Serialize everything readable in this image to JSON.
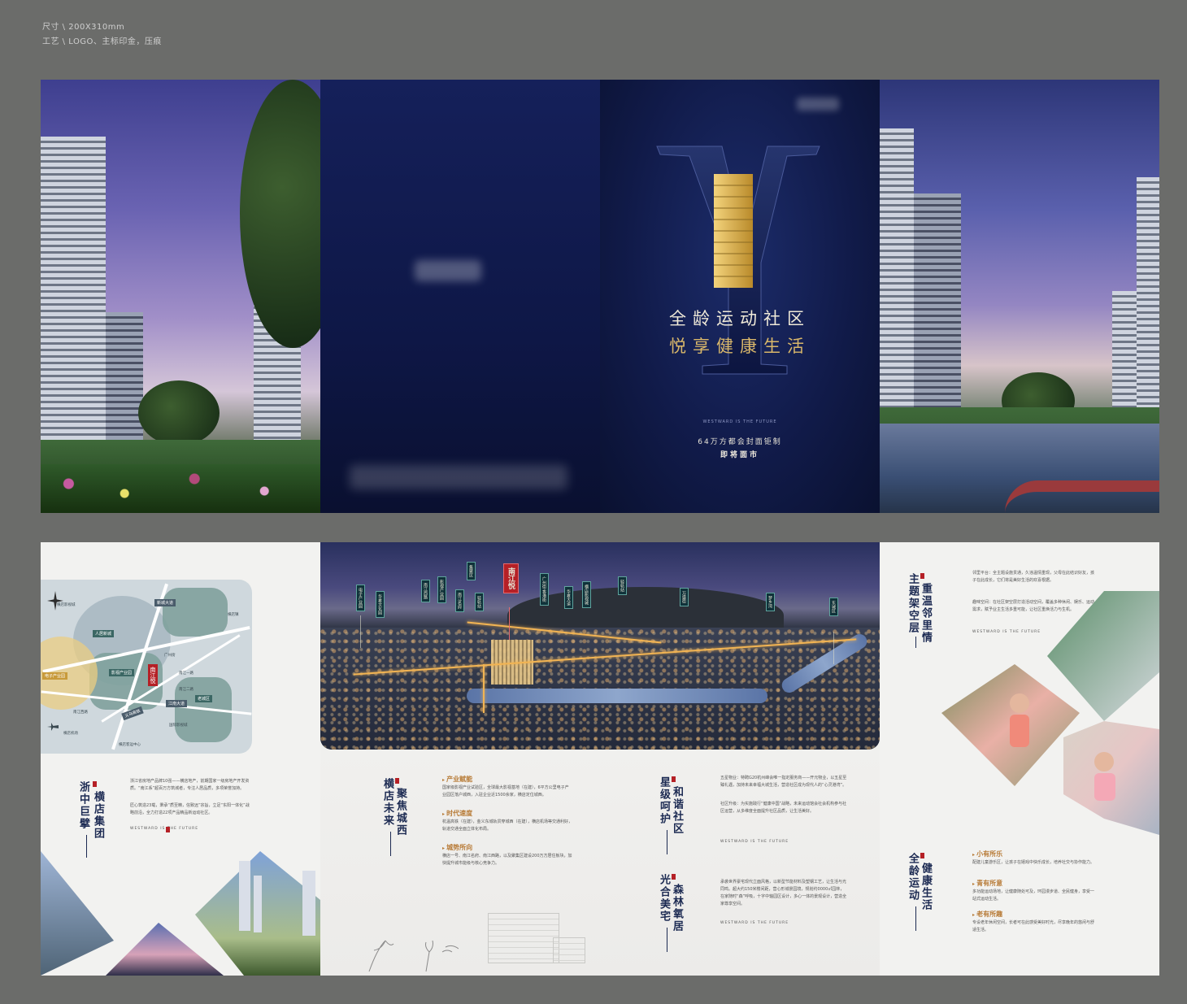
{
  "spec": {
    "size_line": "尺寸 \\ 200X310mm",
    "craft_line": "工艺 \\ LOGO、主标印金，压痕"
  },
  "cover": {
    "letter": "Y",
    "title_line1": "全龄运动社区",
    "title_line2": "悦享健康生活",
    "en_slogan": "WESTWARD IS THE FUTURE",
    "sub_line1": "64万方都会封面钜制",
    "sub_line2": "即将面市"
  },
  "map": {
    "project": "南江悦",
    "labels": [
      "人居新城",
      "影视产业园",
      "老城区",
      "电子产业园",
      "新城大道",
      "江南大道",
      "义乌高铁",
      "横店影视城"
    ],
    "small": [
      "横店机场",
      "南江一路",
      "南江二路",
      "广州街",
      "南江西路",
      "横店客运中心",
      "国际影视城",
      "横店镇"
    ]
  },
  "section1": {
    "title_a": "浙中巨擘",
    "title_b": "横店集团",
    "body1": "浙江省房地产品牌10强——横店地产，前期国家一级房地产开发资质。“南江系”超百万方筑城者，专注人居品质，多项荣誉加持。",
    "body2": "匠心筑造23载，秉承“质至精，信致远”宗旨，立足“东阳一体化”战略前沿，全力打造22项产品精品新运动社区。",
    "en": "WESTWARD IS THE FUTURE"
  },
  "aerial": {
    "project": "南江悦",
    "tags": [
      "电子产业园",
      "华夏文化园",
      "南江西路",
      "影视产业园",
      "南江名府",
      "集聚区",
      "轻轨站",
      "广州街·香港街",
      "华夏大道",
      "横店影视城",
      "轻轨站",
      "万盛街",
      "梦乡湾",
      "东城区"
    ]
  },
  "section2": {
    "title_a": "横店未来",
    "title_b": "聚焦城西",
    "items": [
      {
        "head": "产业赋能",
        "body": "国家级影视产业试验区，全球最大影视基地（在建），6平方公里电子产业园区落户城西，入驻企业近1500余家，横店定位城西。"
      },
      {
        "head": "时代速度",
        "body": "杭温高铁（在建），金义东城轨贯穿城西（在建），横店机场等交通利好，轨道交通全面立体化布局。"
      },
      {
        "head": "城势所向",
        "body": "横店一号、南江名府、南江西路，以及聚集区建设200万方居住板块，加快提升城市能级与核心竞争力。"
      }
    ]
  },
  "section3": {
    "title_a": "星级呵护",
    "title_b": "和谐社区",
    "body1": "五星物业：特聘G20杭州峰会唯一指定服务商——开元物业，以五星至臻礼遇，加持未来幸福大城生活，营造社区成为现代人的“心灵港湾”。",
    "body2": "社区升级：为实施践行“健康中国”战略，未来运动馆会社会机构参与社区运营，从多维度全面提升社区品质，让生活美好。",
    "en": "WESTWARD IS THE FUTURE"
  },
  "section4": {
    "title_a": "光合美宅",
    "title_b": "森林氧居",
    "body": "承袭世界豪宅现代立面风格，以新型节能材料及塑钢工艺，让生活与光同鸣。超大约150米楼间距，营心形城景园境，规划约0000㎡园林，在家随时“森”呼吸，十字中轴园区设计，多心一体的景观设计，营造全家尊享空间。",
    "en": "WESTWARD IS THE FUTURE"
  },
  "section5": {
    "title_a": "主题架空层",
    "title_b": "重温邻里情",
    "body1": "邻里平台：全主题设施贯通，久违温情重现，父母在此结识好友，孩子在此成长，它们将是美好生活的欢喜根据。",
    "body2": "趣味空间：在社区架空层打造活动空间，覆盖多种休闲、娱乐、运动需求，赋予业主生活多重可能，让社区重焕活力与生机。",
    "en": "WESTWARD IS THE FUTURE"
  },
  "section6": {
    "title_a": "全龄运动",
    "title_b": "健康生活",
    "items": [
      {
        "head": "小有所乐",
        "body": "配建儿童游乐区，让孩子在嬉戏中快乐成长，培养社交与协作能力。"
      },
      {
        "head": "青有所意",
        "body": "多功能运动场地，让健康随处可及，环园漫步道、全民健身，享受一站式运动生活。"
      },
      {
        "head": "老有所趣",
        "body": "专设老年休闲空间，长者可在此感受美好时光，尽享晚年的悠闲与舒适生活。"
      }
    ]
  },
  "colors": {
    "navy": "#111b4a",
    "gold": "#d9b76a",
    "accent_red": "#b52026",
    "title_navy": "#1c2a52",
    "section_orange": "#b77a35"
  }
}
